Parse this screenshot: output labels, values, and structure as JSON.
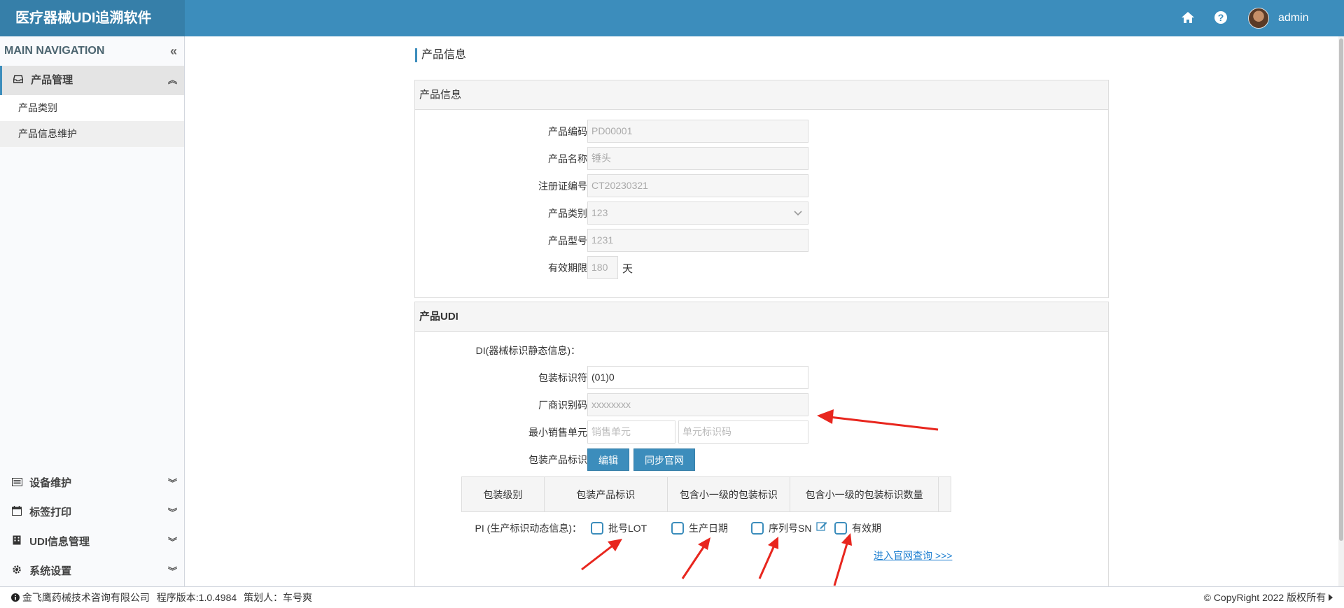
{
  "header": {
    "app_title": "医疗器械UDI追溯软件",
    "username": "admin"
  },
  "sidebar": {
    "nav_title": "MAIN NAVIGATION",
    "active_menu": "产品管理",
    "sub_items": [
      "产品类别",
      "产品信息维护"
    ],
    "bottom_menu": [
      "设备维护",
      "标签打印",
      "UDI信息管理",
      "系统设置"
    ]
  },
  "page": {
    "title": "产品信息"
  },
  "product_info": {
    "panel_title": "产品信息",
    "code_label": "产品编码：",
    "code_value": "PD00001",
    "name_label": "产品名称：",
    "name_value": "锤头",
    "reg_label": "注册证编号：",
    "reg_value": "CT20230321",
    "category_label": "产品类别：",
    "category_value": "123",
    "model_label": "产品型号：",
    "model_value": "1231",
    "validity_label": "有效期限：",
    "validity_value": "180",
    "validity_unit": "天"
  },
  "product_udi": {
    "panel_title": "产品UDI",
    "di_label": "DI(器械标识静态信息)：",
    "pkg_id_label": "包装标识符：",
    "pkg_id_value": "(01)0",
    "vendor_label": "厂商识别码：",
    "vendor_placeholder": "xxxxxxxx",
    "min_unit_label": "最小销售单元：",
    "min_unit_placeholder": "销售单元",
    "unit_code_placeholder": "单元标识码",
    "pkg_product_label": "包装产品标识：",
    "edit_button": "编辑",
    "sync_button": "同步官网",
    "table_headers": [
      "包装级别",
      "包装产品标识",
      "包含小一级的包装标识",
      "包含小一级的包装标识数量"
    ],
    "pi_label": "PI (生产标识动态信息)：",
    "pi_options": [
      "批号LOT",
      "生产日期",
      "序列号SN",
      "有效期"
    ],
    "query_link": "进入官网查询 >>>"
  },
  "footer": {
    "company": "金飞鹰药械技术咨询有限公司",
    "version": "程序版本:1.0.4984",
    "planner": "策划人：车号爽",
    "copyright": "© CopyRight 2022 版权所有"
  },
  "colors": {
    "header": "#3c8dbc",
    "logo_bg": "#367fa9",
    "accent": "#3c8dbc",
    "arrow": "#e8261e"
  }
}
